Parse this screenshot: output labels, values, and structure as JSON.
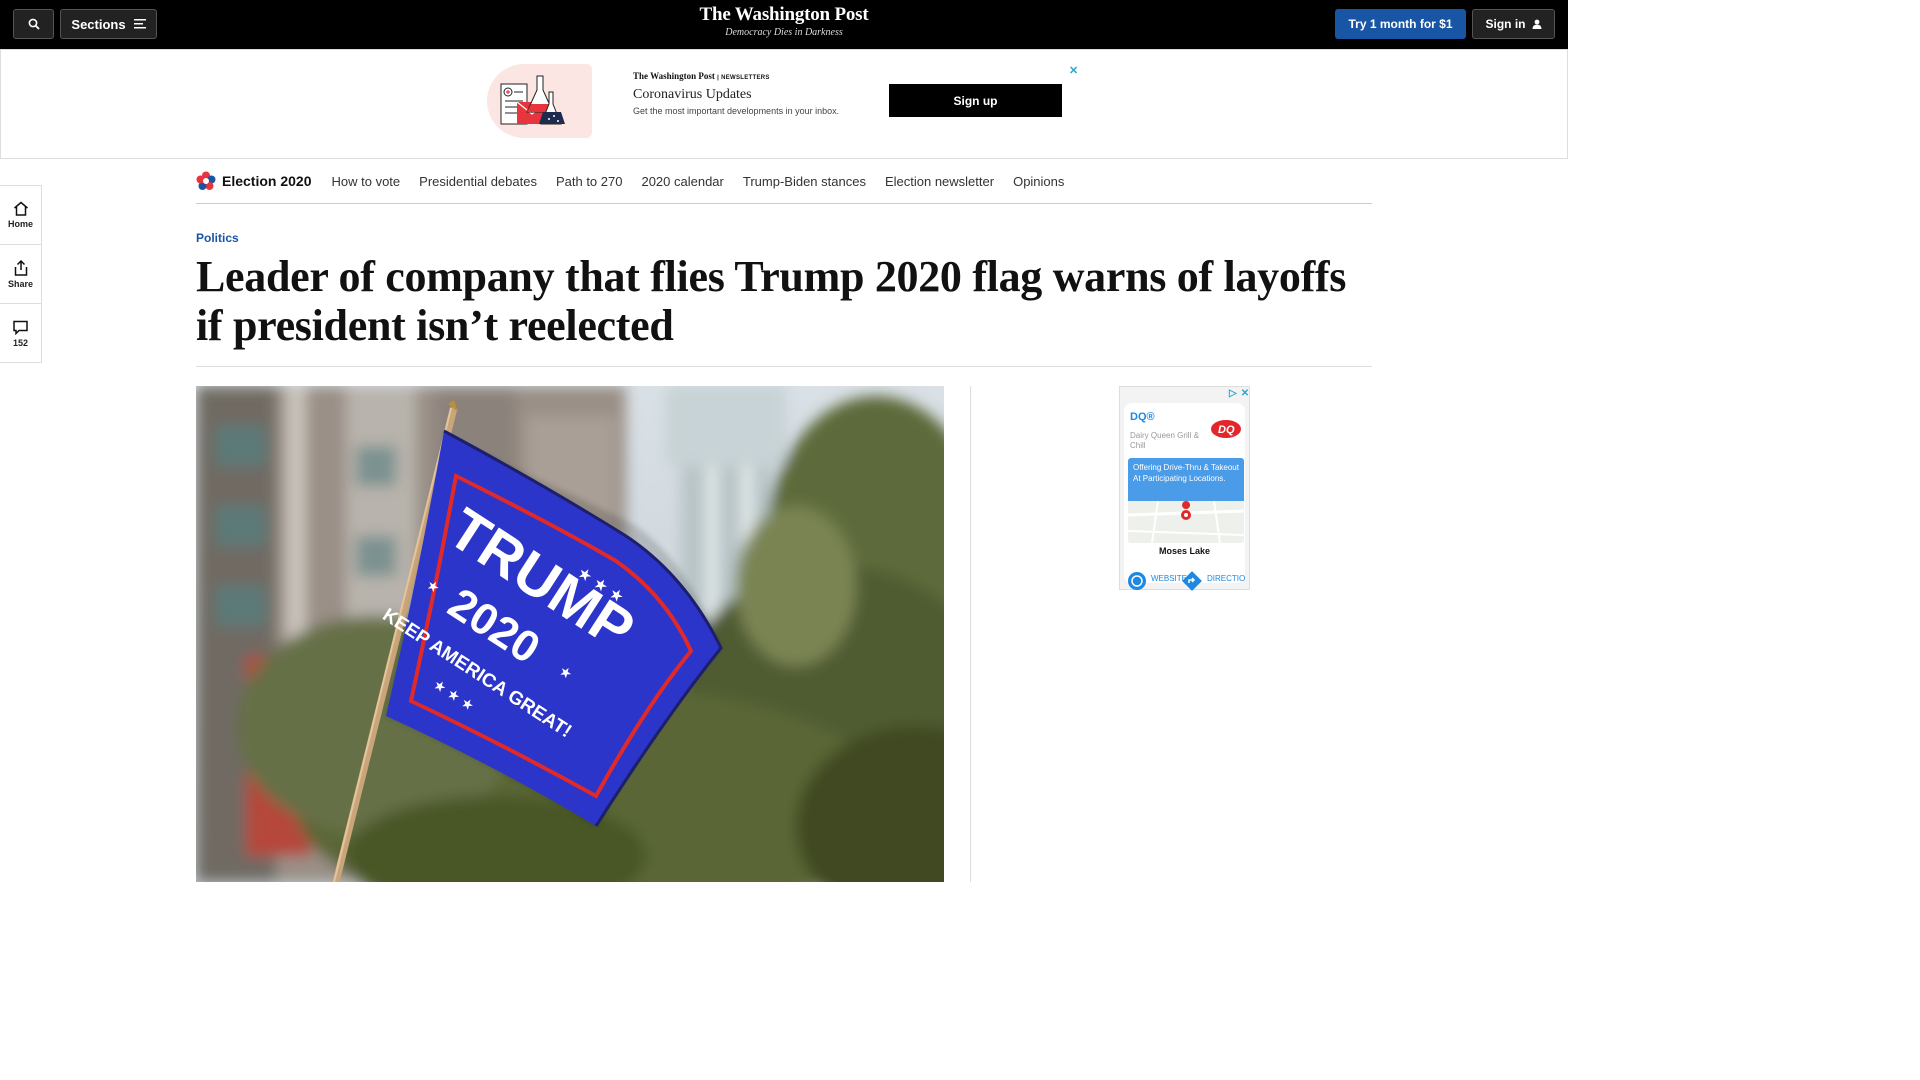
{
  "topbar": {
    "sections_label": "Sections",
    "logo": "The Washington Post",
    "tagline": "Democracy Dies in Darkness",
    "try_label": "Try 1 month for $1",
    "signin_label": "Sign in"
  },
  "ad_banner": {
    "brand": "The Washington Post",
    "brand_sub": "NEWSLETTERS",
    "title": "Coronavirus Updates",
    "description": "Get the most important developments in your inbox.",
    "signup_label": "Sign up",
    "close": "✕",
    "accent_color": "#e8343c"
  },
  "rail": {
    "home_label": "Home",
    "share_label": "Share",
    "comments_count": "152"
  },
  "election_nav": {
    "title": "Election 2020",
    "links": [
      "How to vote",
      "Presidential debates",
      "Path to 270",
      "2020 calendar",
      "Trump-Biden stances",
      "Election newsletter",
      "Opinions"
    ]
  },
  "article": {
    "kicker": "Politics",
    "headline": "Leader of company that flies Trump 2020 flag warns of layoffs if president isn’t reelected",
    "kicker_color": "#1955a5"
  },
  "photo": {
    "flag_word": "TRUMP",
    "flag_year": "2020",
    "flag_slogan": "KEEP AMERICA GREAT!",
    "flag_color": "#2b35c9"
  },
  "right_ad": {
    "brand": "DQ®",
    "subtitle": "Dairy Queen Grill & Chill",
    "promo": "Offering Drive-Thru & Takeout At Participating Locations.",
    "city": "Moses Lake",
    "website_label": "WEBSITE",
    "directions_label": "DIRECTIONS",
    "adchoices": "▷",
    "close": "✕"
  }
}
